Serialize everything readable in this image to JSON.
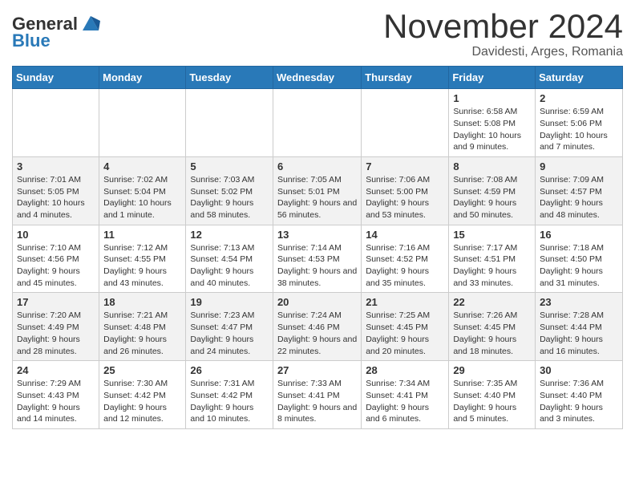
{
  "header": {
    "logo_general": "General",
    "logo_blue": "Blue",
    "month_title": "November 2024",
    "location": "Davidesti, Arges, Romania"
  },
  "weekdays": [
    "Sunday",
    "Monday",
    "Tuesday",
    "Wednesday",
    "Thursday",
    "Friday",
    "Saturday"
  ],
  "weeks": [
    [
      {
        "day": "",
        "info": ""
      },
      {
        "day": "",
        "info": ""
      },
      {
        "day": "",
        "info": ""
      },
      {
        "day": "",
        "info": ""
      },
      {
        "day": "",
        "info": ""
      },
      {
        "day": "1",
        "info": "Sunrise: 6:58 AM\nSunset: 5:08 PM\nDaylight: 10 hours and 9 minutes."
      },
      {
        "day": "2",
        "info": "Sunrise: 6:59 AM\nSunset: 5:06 PM\nDaylight: 10 hours and 7 minutes."
      }
    ],
    [
      {
        "day": "3",
        "info": "Sunrise: 7:01 AM\nSunset: 5:05 PM\nDaylight: 10 hours and 4 minutes."
      },
      {
        "day": "4",
        "info": "Sunrise: 7:02 AM\nSunset: 5:04 PM\nDaylight: 10 hours and 1 minute."
      },
      {
        "day": "5",
        "info": "Sunrise: 7:03 AM\nSunset: 5:02 PM\nDaylight: 9 hours and 58 minutes."
      },
      {
        "day": "6",
        "info": "Sunrise: 7:05 AM\nSunset: 5:01 PM\nDaylight: 9 hours and 56 minutes."
      },
      {
        "day": "7",
        "info": "Sunrise: 7:06 AM\nSunset: 5:00 PM\nDaylight: 9 hours and 53 minutes."
      },
      {
        "day": "8",
        "info": "Sunrise: 7:08 AM\nSunset: 4:59 PM\nDaylight: 9 hours and 50 minutes."
      },
      {
        "day": "9",
        "info": "Sunrise: 7:09 AM\nSunset: 4:57 PM\nDaylight: 9 hours and 48 minutes."
      }
    ],
    [
      {
        "day": "10",
        "info": "Sunrise: 7:10 AM\nSunset: 4:56 PM\nDaylight: 9 hours and 45 minutes."
      },
      {
        "day": "11",
        "info": "Sunrise: 7:12 AM\nSunset: 4:55 PM\nDaylight: 9 hours and 43 minutes."
      },
      {
        "day": "12",
        "info": "Sunrise: 7:13 AM\nSunset: 4:54 PM\nDaylight: 9 hours and 40 minutes."
      },
      {
        "day": "13",
        "info": "Sunrise: 7:14 AM\nSunset: 4:53 PM\nDaylight: 9 hours and 38 minutes."
      },
      {
        "day": "14",
        "info": "Sunrise: 7:16 AM\nSunset: 4:52 PM\nDaylight: 9 hours and 35 minutes."
      },
      {
        "day": "15",
        "info": "Sunrise: 7:17 AM\nSunset: 4:51 PM\nDaylight: 9 hours and 33 minutes."
      },
      {
        "day": "16",
        "info": "Sunrise: 7:18 AM\nSunset: 4:50 PM\nDaylight: 9 hours and 31 minutes."
      }
    ],
    [
      {
        "day": "17",
        "info": "Sunrise: 7:20 AM\nSunset: 4:49 PM\nDaylight: 9 hours and 28 minutes."
      },
      {
        "day": "18",
        "info": "Sunrise: 7:21 AM\nSunset: 4:48 PM\nDaylight: 9 hours and 26 minutes."
      },
      {
        "day": "19",
        "info": "Sunrise: 7:23 AM\nSunset: 4:47 PM\nDaylight: 9 hours and 24 minutes."
      },
      {
        "day": "20",
        "info": "Sunrise: 7:24 AM\nSunset: 4:46 PM\nDaylight: 9 hours and 22 minutes."
      },
      {
        "day": "21",
        "info": "Sunrise: 7:25 AM\nSunset: 4:45 PM\nDaylight: 9 hours and 20 minutes."
      },
      {
        "day": "22",
        "info": "Sunrise: 7:26 AM\nSunset: 4:45 PM\nDaylight: 9 hours and 18 minutes."
      },
      {
        "day": "23",
        "info": "Sunrise: 7:28 AM\nSunset: 4:44 PM\nDaylight: 9 hours and 16 minutes."
      }
    ],
    [
      {
        "day": "24",
        "info": "Sunrise: 7:29 AM\nSunset: 4:43 PM\nDaylight: 9 hours and 14 minutes."
      },
      {
        "day": "25",
        "info": "Sunrise: 7:30 AM\nSunset: 4:42 PM\nDaylight: 9 hours and 12 minutes."
      },
      {
        "day": "26",
        "info": "Sunrise: 7:31 AM\nSunset: 4:42 PM\nDaylight: 9 hours and 10 minutes."
      },
      {
        "day": "27",
        "info": "Sunrise: 7:33 AM\nSunset: 4:41 PM\nDaylight: 9 hours and 8 minutes."
      },
      {
        "day": "28",
        "info": "Sunrise: 7:34 AM\nSunset: 4:41 PM\nDaylight: 9 hours and 6 minutes."
      },
      {
        "day": "29",
        "info": "Sunrise: 7:35 AM\nSunset: 4:40 PM\nDaylight: 9 hours and 5 minutes."
      },
      {
        "day": "30",
        "info": "Sunrise: 7:36 AM\nSunset: 4:40 PM\nDaylight: 9 hours and 3 minutes."
      }
    ]
  ]
}
